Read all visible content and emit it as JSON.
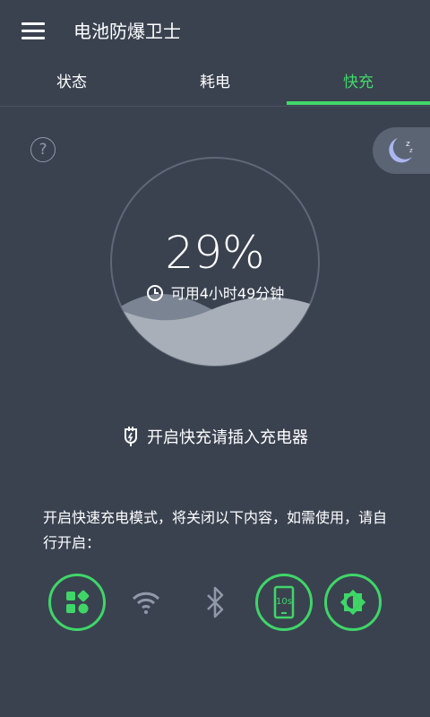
{
  "app": {
    "title": "电池防爆卫士"
  },
  "tabs": [
    {
      "label": "状态",
      "active": false
    },
    {
      "label": "耗电",
      "active": false
    },
    {
      "label": "快充",
      "active": true
    }
  ],
  "battery": {
    "percent_text": "29%",
    "level": 0.29,
    "remaining_text": "可用4小时49分钟"
  },
  "charge_prompt": "开启快充请插入充电器",
  "notice": "开启快速充电模式，将关闭以下内容，如需使用，请自行开启：",
  "features": [
    {
      "icon": "apps-icon",
      "enabled": true
    },
    {
      "icon": "wifi-icon",
      "enabled": false
    },
    {
      "icon": "bluetooth-icon",
      "enabled": false
    },
    {
      "icon": "screen-timeout-icon",
      "label": "10s",
      "enabled": true
    },
    {
      "icon": "brightness-icon",
      "enabled": true
    }
  ],
  "colors": {
    "background": "#3a4250",
    "accent": "#42d96a",
    "inactive_icon": "#8f99a8"
  }
}
